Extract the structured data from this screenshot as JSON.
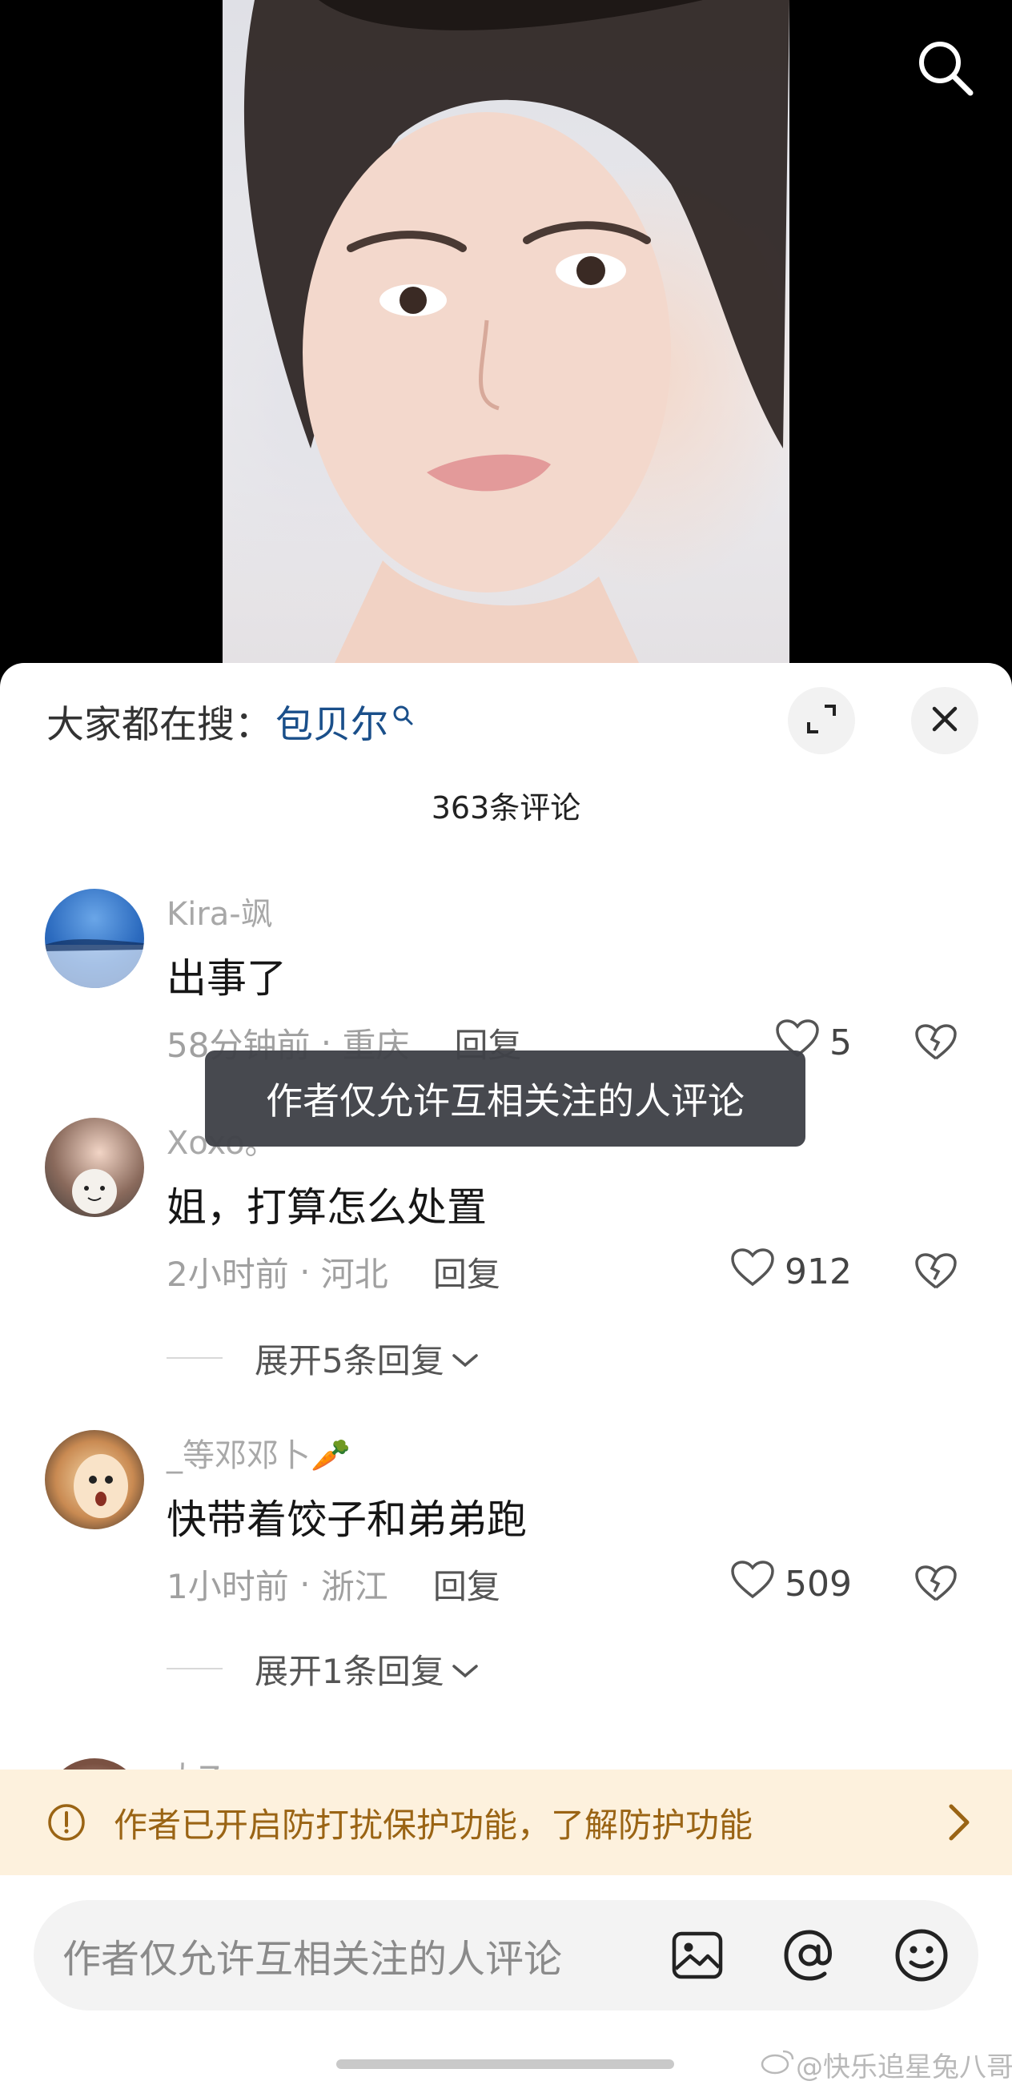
{
  "video": {
    "search_icon": "search-icon"
  },
  "sheet": {
    "trending_label": "大家都在搜：",
    "trending_term": "包贝尔",
    "comment_count": "363条评论",
    "expand_icon": "fullscreen-icon",
    "close_icon": "close-icon"
  },
  "comments": [
    {
      "username": "Kira-飒",
      "content": "出事了",
      "time": "58分钟前",
      "location": "重庆",
      "reply_label": "回复",
      "likes": "5"
    },
    {
      "username": "Xoxo。",
      "content": "姐，打算怎么处置",
      "time": "2小时前",
      "location": "河北",
      "reply_label": "回复",
      "likes": "912",
      "expand_label": "展开5条回复"
    },
    {
      "username": "_等邓邓卜🥕",
      "content": "快带着饺子和弟弟跑",
      "time": "1小时前",
      "location": "浙江",
      "reply_label": "回复",
      "likes": "509",
      "expand_label": "展开1条回复"
    },
    {
      "username": "大Z"
    }
  ],
  "toast": "作者仅允许互相关注的人评论",
  "banner": {
    "text": "作者已开启防打扰保护功能，了解防护功能"
  },
  "input": {
    "placeholder": "作者仅允许互相关注的人评论"
  },
  "watermark": "@快乐追星兔八哥",
  "colors": {
    "trending_term": "#1a4f8a",
    "banner_bg": "#fdf1dd",
    "banner_text": "#9a6414",
    "toast_bg": "#404248"
  }
}
